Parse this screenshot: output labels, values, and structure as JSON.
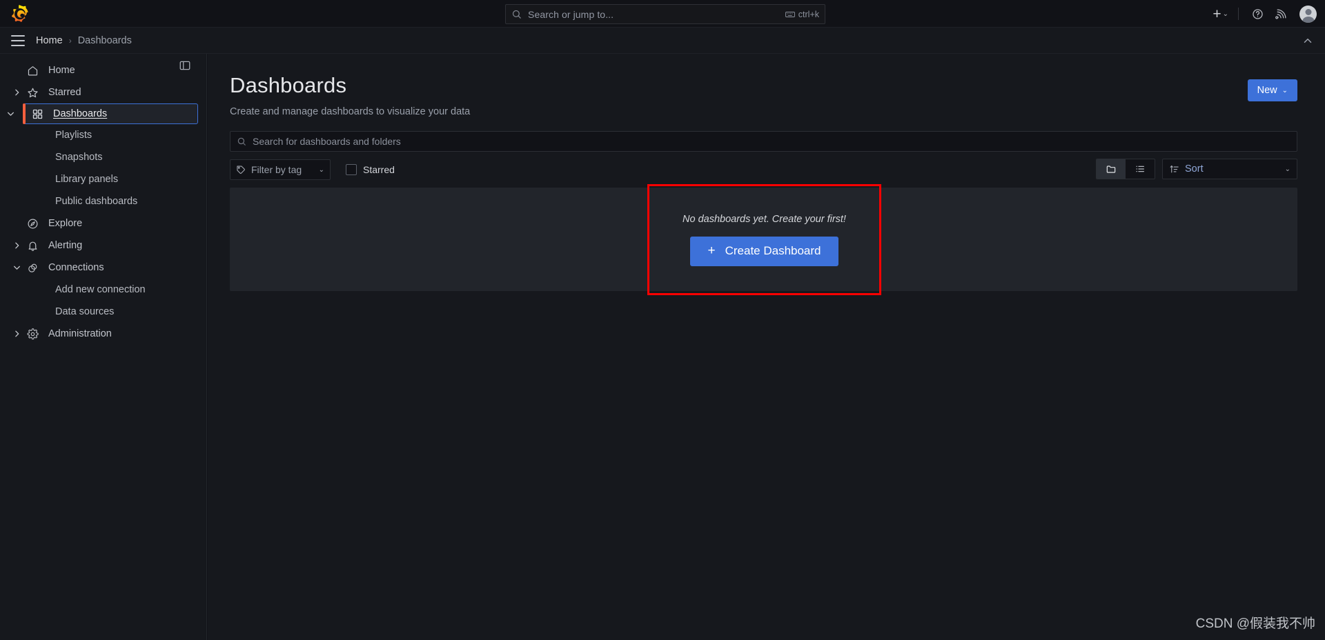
{
  "topbar": {
    "logo_name": "grafana-logo",
    "search": {
      "placeholder": "Search or jump to...",
      "shortcut": "ctrl+k"
    },
    "actions": {
      "new_plus": "+",
      "chevron": "⌄",
      "help_icon": "help-circle-icon",
      "news_icon": "news-rss-icon",
      "avatar": "user-avatar"
    }
  },
  "breadcrumb": {
    "menu_icon": "hamburger-menu-icon",
    "items": [
      {
        "label": "Home"
      },
      {
        "label": "Dashboards"
      }
    ],
    "separator": "›",
    "collapse_icon": "chevron-up-icon"
  },
  "sidebar": {
    "dock_icon": "dock-panel-icon",
    "items": [
      {
        "label": "Home",
        "icon": "home-icon",
        "level": 0,
        "expandable": false,
        "active": false
      },
      {
        "label": "Starred",
        "icon": "star-icon",
        "level": 0,
        "expandable": true,
        "expanded": false,
        "active": false
      },
      {
        "label": "Dashboards",
        "icon": "dashboards-grid-icon",
        "level": 0,
        "expandable": true,
        "expanded": true,
        "active": true
      },
      {
        "label": "Playlists",
        "icon": "",
        "level": 1,
        "expandable": false,
        "active": false
      },
      {
        "label": "Snapshots",
        "icon": "",
        "level": 1,
        "expandable": false,
        "active": false
      },
      {
        "label": "Library panels",
        "icon": "",
        "level": 1,
        "expandable": false,
        "active": false
      },
      {
        "label": "Public dashboards",
        "icon": "",
        "level": 1,
        "expandable": false,
        "active": false
      },
      {
        "label": "Explore",
        "icon": "compass-icon",
        "level": 0,
        "expandable": false,
        "active": false
      },
      {
        "label": "Alerting",
        "icon": "bell-icon",
        "level": 0,
        "expandable": true,
        "expanded": false,
        "active": false
      },
      {
        "label": "Connections",
        "icon": "connections-icon",
        "level": 0,
        "expandable": true,
        "expanded": true,
        "active": false
      },
      {
        "label": "Add new connection",
        "icon": "",
        "level": 1,
        "expandable": false,
        "active": false
      },
      {
        "label": "Data sources",
        "icon": "",
        "level": 1,
        "expandable": false,
        "active": false
      },
      {
        "label": "Administration",
        "icon": "gear-icon",
        "level": 0,
        "expandable": true,
        "expanded": false,
        "active": false
      }
    ]
  },
  "main": {
    "title": "Dashboards",
    "subtitle": "Create and manage dashboards to visualize your data",
    "new_button": {
      "label": "New",
      "chevron": "⌄"
    },
    "search": {
      "placeholder": "Search for dashboards and folders",
      "value": ""
    },
    "filters": {
      "tag": {
        "label": "Filter by tag",
        "icon": "tag-icon",
        "chevron": "⌄"
      },
      "starred": {
        "label": "Starred",
        "checked": false
      }
    },
    "view_toggle": {
      "folder": {
        "icon": "folder-icon",
        "active": true
      },
      "list": {
        "icon": "list-icon",
        "active": false
      }
    },
    "sort": {
      "label": "Sort",
      "icon": "sort-amount-icon",
      "chevron": "⌄"
    },
    "empty_state": {
      "message": "No dashboards yet. Create your first!",
      "button": {
        "label": "Create Dashboard",
        "plus": "+"
      }
    }
  },
  "annotation": {
    "highlight_color": "#fe0000"
  },
  "watermark": {
    "text": "CSDN @假装我不帅"
  }
}
